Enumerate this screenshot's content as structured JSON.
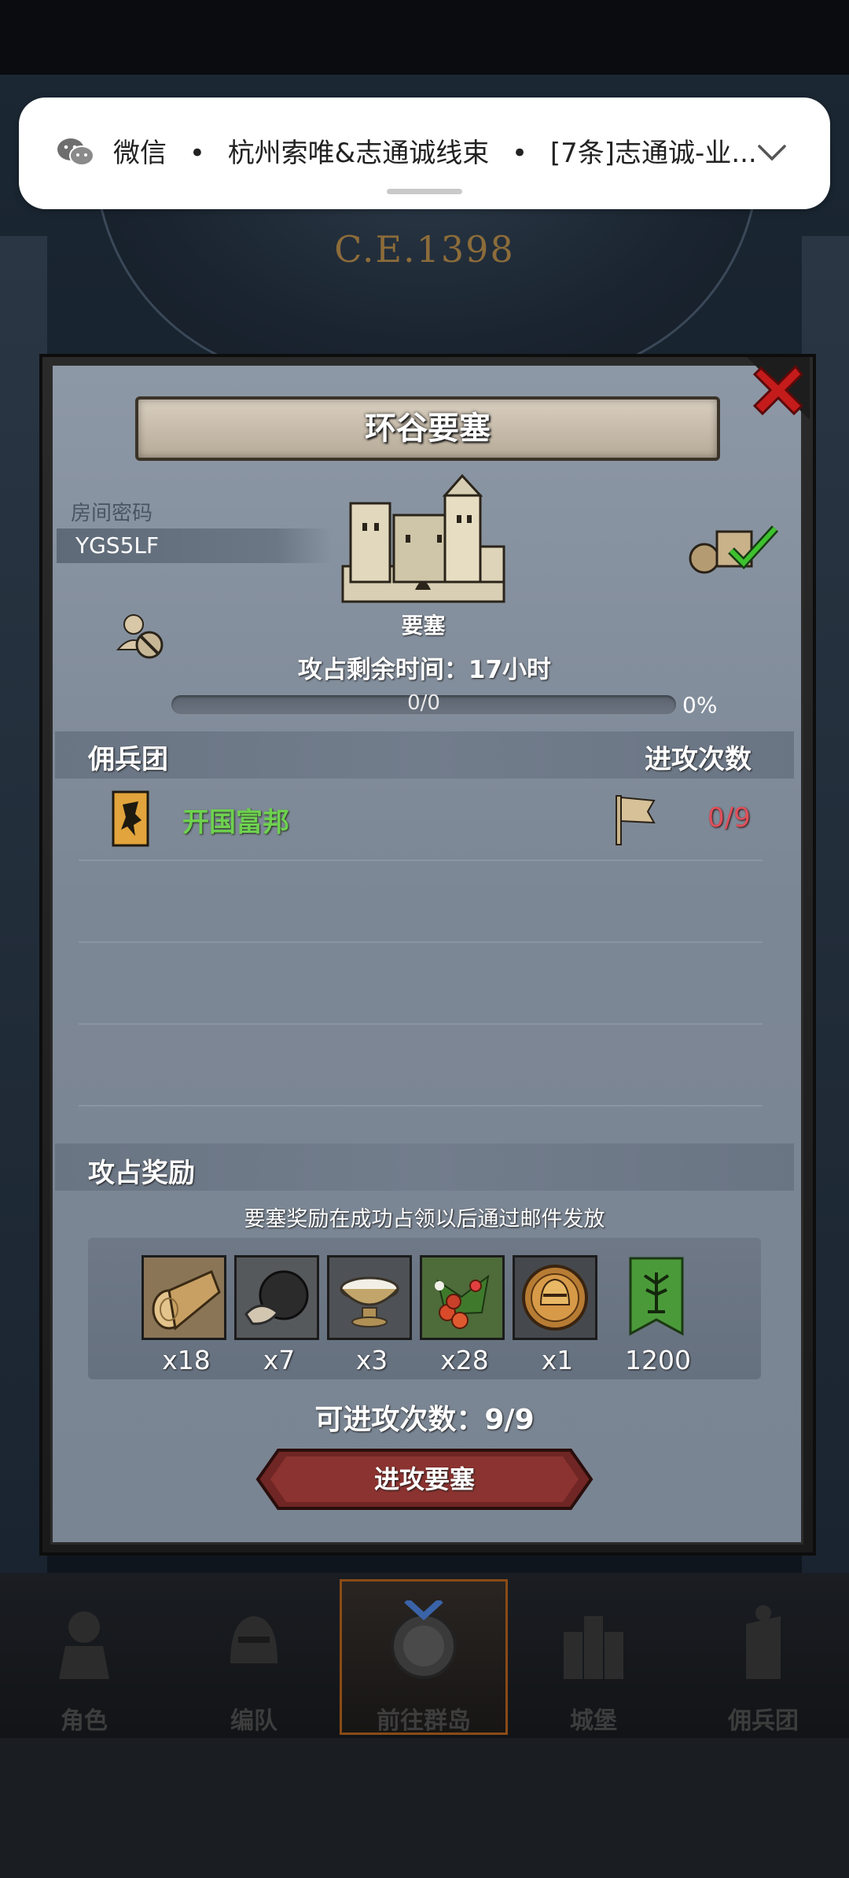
{
  "notification": {
    "app": "微信",
    "sender": "杭州索唯&志通诚线束",
    "message": "[7条]志通诚-业...",
    "separator": "•",
    "icon": "wechat-icon",
    "chevron": "chevron-down-icon"
  },
  "background": {
    "era": "C.E.1398"
  },
  "dialog": {
    "title": "环谷要塞",
    "room_code_label": "房间密码",
    "room_code": "YGS5LF",
    "building_label": "要塞",
    "time_left": "攻占剩余时间：17小时",
    "progress_text": "0/0",
    "progress_percent": "0%",
    "progress_fraction": 0,
    "mercenary_header": "佣兵团",
    "attacks_header": "进攻次数",
    "mercenaries": [
      {
        "name": "开国富邦",
        "attacks": "0/9"
      }
    ],
    "rewards_header": "攻占奖励",
    "rewards_note": "要塞奖励在成功占领以后通过邮件发放",
    "rewards": [
      {
        "icon": "wood-log-icon",
        "qty": "x18"
      },
      {
        "icon": "truffle-icon",
        "qty": "x7"
      },
      {
        "icon": "salt-bowl-icon",
        "qty": "x3"
      },
      {
        "icon": "berries-icon",
        "qty": "x28"
      },
      {
        "icon": "helmet-coin-icon",
        "qty": "x1"
      },
      {
        "icon": "guild-banner-icon",
        "qty": "1200"
      }
    ],
    "attack_count": "可进攻次数：9/9",
    "attack_button": "进攻要塞"
  },
  "bottom_nav": [
    {
      "label": "角色",
      "icon": "knight-icon",
      "active": false
    },
    {
      "label": "编队",
      "icon": "helmet-icon",
      "active": false
    },
    {
      "label": "前往群岛",
      "icon": "compass-icon",
      "active": true
    },
    {
      "label": "城堡",
      "icon": "castle-icon",
      "active": false
    },
    {
      "label": "佣兵团",
      "icon": "mercenary-icon",
      "active": false
    }
  ],
  "colors": {
    "mercenary_name": "#6ed14f",
    "attack_count": "#e0505a",
    "panel": "#838e9c",
    "button": "#7a2d2a"
  }
}
